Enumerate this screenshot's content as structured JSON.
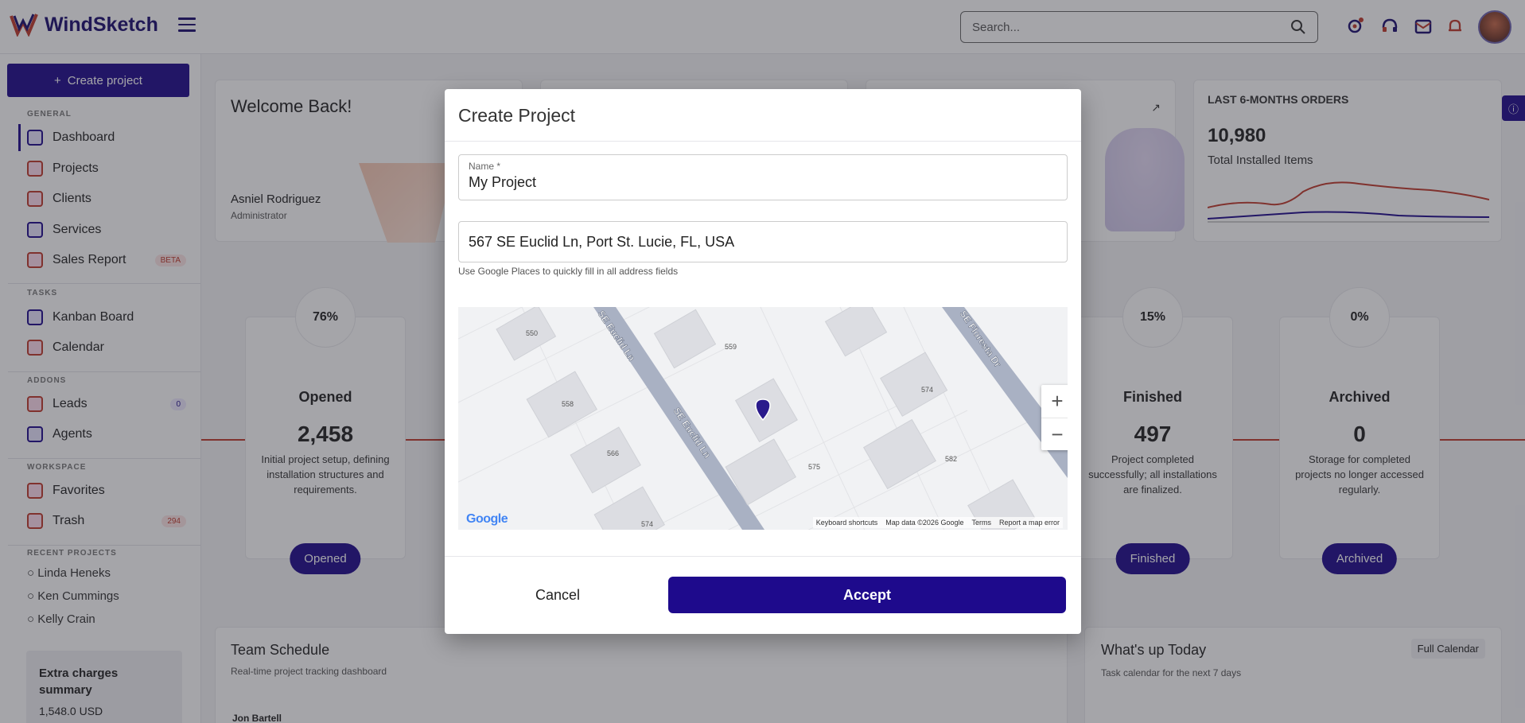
{
  "header": {
    "app_name": "WindSketch",
    "search_placeholder": "Search...",
    "icons": [
      "settings-icon",
      "support-icon",
      "mail-icon",
      "bell-icon"
    ]
  },
  "sidebar": {
    "create_label": "Create project",
    "sections": {
      "general": "GENERAL",
      "tasks": "TASKS",
      "addons": "ADDONS",
      "workspace": "WORKSPACE",
      "recent": "RECENT PROJECTS"
    },
    "items": {
      "dashboard": "Dashboard",
      "projects": "Projects",
      "clients": "Clients",
      "services": "Services",
      "sales_report": "Sales Report",
      "sales_badge": "BETA",
      "kanban": "Kanban Board",
      "calendar": "Calendar",
      "leads": "Leads",
      "leads_badge": "0",
      "agents": "Agents",
      "favorites": "Favorites",
      "trash": "Trash",
      "trash_badge": "294"
    },
    "recent_projects": [
      "Linda Heneks",
      "Ken Cummings",
      "Kelly Crain"
    ],
    "extra": {
      "title": "Extra charges summary",
      "value": "1,548.0 USD"
    }
  },
  "dashboard": {
    "welcome": "Welcome Back!",
    "user_name": "Asniel Rodriguez",
    "user_role": "Administrator",
    "orders_title": "LAST 6-MONTHS ORDERS",
    "orders_value": "10,980",
    "orders_label": "Total Installed Items",
    "stats": [
      {
        "pct": "76%",
        "title": "Opened",
        "num": "2,458",
        "desc": "Initial project setup, defining installation structures and requirements.",
        "btn": "Opened"
      },
      {
        "pct": "15%",
        "title": "Finished",
        "num": "497",
        "desc": "Project completed successfully; all installations are finalized.",
        "btn": "Finished"
      },
      {
        "pct": "0%",
        "title": "Archived",
        "num": "0",
        "desc": "Storage for completed projects no longer accessed regularly.",
        "btn": "Archived"
      }
    ],
    "team_title": "Team Schedule",
    "team_sub": "Real-time project tracking dashboard",
    "team_row": "Jon Bartell",
    "today_title": "What's up Today",
    "today_sub": "Task calendar for the next 7 days",
    "today_btn": "Full Calendar"
  },
  "modal": {
    "title": "Create Project",
    "name_label": "Name *",
    "name_value": "My Project",
    "address_value": "567 SE Euclid Ln, Port St. Lucie, FL, USA",
    "address_help": "Use Google Places to quickly fill in all address fields",
    "map": {
      "labels": [
        "550",
        "559",
        "558",
        "566",
        "574",
        "575",
        "574",
        "582",
        "SE Euclid Ln",
        "SE Euclid Ln",
        "SE Floresta Dr"
      ],
      "footer": [
        "Keyboard shortcuts",
        "Map data ©2026 Google",
        "Terms",
        "Report a map error"
      ],
      "brand": "Google"
    },
    "cancel_label": "Cancel",
    "accept_label": "Accept"
  }
}
